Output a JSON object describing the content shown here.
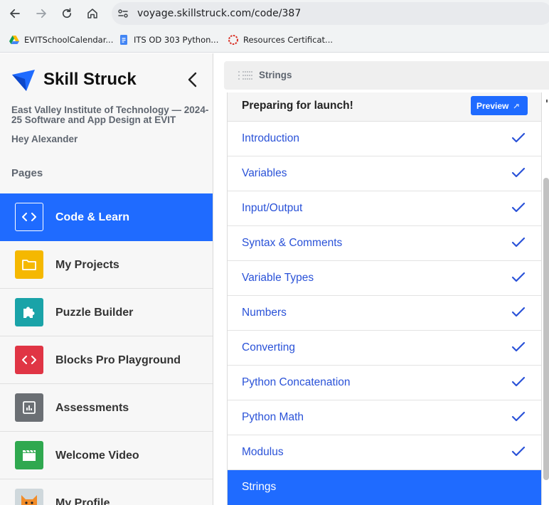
{
  "browser": {
    "url": "voyage.skillstruck.com/code/387",
    "bookmarks": [
      {
        "label": "EVITSchoolCalendar...",
        "icon": "google-drive-icon"
      },
      {
        "label": "ITS OD 303 Python...",
        "icon": "google-docs-icon"
      },
      {
        "label": "Resources Certificat...",
        "icon": "resources-icon"
      }
    ]
  },
  "sidebar": {
    "brand": "Skill Struck",
    "org": "East Valley Institute of Technology — 2024-25 Software and App Design at EVIT",
    "greeting": "Hey Alexander",
    "pages_label": "Pages",
    "items": [
      {
        "label": "Code & Learn",
        "icon": "code-brackets-icon",
        "color": "#1f6bff",
        "active": true
      },
      {
        "label": "My Projects",
        "icon": "folder-icon",
        "color": "#f5b800"
      },
      {
        "label": "Puzzle Builder",
        "icon": "puzzle-piece-icon",
        "color": "#1aa3a8"
      },
      {
        "label": "Blocks Pro Playground",
        "icon": "code-brackets-icon",
        "color": "#e03545"
      },
      {
        "label": "Assessments",
        "icon": "bar-chart-icon",
        "color": "#6b6f74"
      },
      {
        "label": "Welcome Video",
        "icon": "clapperboard-icon",
        "color": "#2fa84f"
      },
      {
        "label": "My Profile",
        "icon": "fox-avatar-icon",
        "color": "#cfd8dc"
      }
    ]
  },
  "content": {
    "header_title": "Strings",
    "panel_title": "Preparing for launch!",
    "preview_label": "Preview",
    "lessons": [
      {
        "label": "Introduction",
        "completed": true
      },
      {
        "label": "Variables",
        "completed": true
      },
      {
        "label": "Input/Output",
        "completed": true
      },
      {
        "label": "Syntax & Comments",
        "completed": true
      },
      {
        "label": "Variable Types",
        "completed": true
      },
      {
        "label": "Numbers",
        "completed": true
      },
      {
        "label": "Converting",
        "completed": true
      },
      {
        "label": "Python Concatenation",
        "completed": true
      },
      {
        "label": "Python Math",
        "completed": true
      },
      {
        "label": "Modulus",
        "completed": true
      },
      {
        "label": "Strings",
        "completed": false,
        "current": true
      }
    ]
  },
  "colors": {
    "accent": "#1f6bff",
    "lesson_text": "#2a52d8",
    "sidebar_bg": "#f7f7f7"
  }
}
